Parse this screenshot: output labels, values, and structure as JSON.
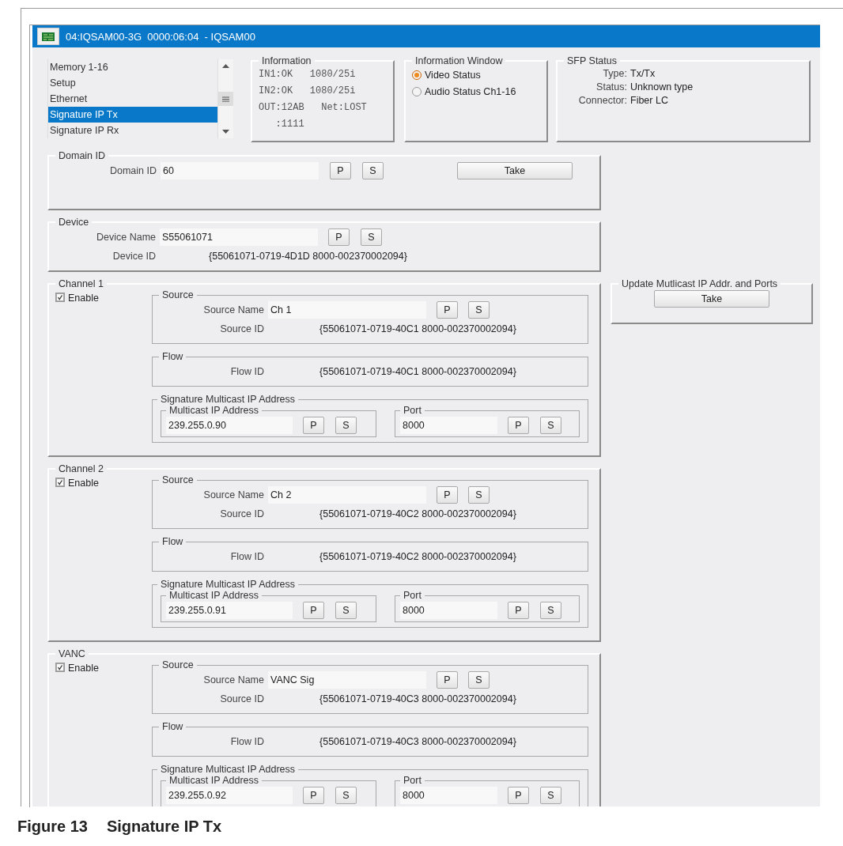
{
  "window": {
    "title": "04:IQSAM00-3G  0000:06:04  - IQSAM00"
  },
  "menu_list": {
    "items": [
      {
        "label": "Memory 1-16",
        "selected": false
      },
      {
        "label": "Setup",
        "selected": false
      },
      {
        "label": "Ethernet",
        "selected": false
      },
      {
        "label": "Signature IP Tx",
        "selected": true
      },
      {
        "label": "Signature IP Rx",
        "selected": false
      }
    ]
  },
  "information": {
    "title": "Information",
    "lines": [
      "IN1:OK   1080/25i",
      "IN2:OK   1080/25i",
      "OUT:12AB   Net:LOST",
      "   :1111"
    ]
  },
  "information_window": {
    "title": "Information Window",
    "options": [
      {
        "label": "Video Status",
        "selected": true
      },
      {
        "label": "Audio Status Ch1-16",
        "selected": false
      }
    ]
  },
  "sfp_status": {
    "title": "SFP Status",
    "rows": [
      {
        "label": "Type:",
        "value": "Tx/Tx"
      },
      {
        "label": "Status:",
        "value": "Unknown type"
      },
      {
        "label": "Connector:",
        "value": "Fiber LC"
      }
    ]
  },
  "domain_id": {
    "title": "Domain ID",
    "label": "Domain ID",
    "value": "60",
    "buttons": [
      "P",
      "S"
    ],
    "take": "Take"
  },
  "device": {
    "title": "Device",
    "name_label": "Device Name",
    "name_value": "S55061071",
    "buttons": [
      "P",
      "S"
    ],
    "id_label": "Device ID",
    "id_value": "{55061071-0719-4D1D 8000-002370002094}"
  },
  "channels": [
    {
      "title": "Channel 1",
      "enable": {
        "label": "Enable",
        "checked": true
      },
      "source": {
        "title": "Source",
        "name_label": "Source Name",
        "name_value": "Ch 1",
        "buttons": [
          "P",
          "S"
        ],
        "id_label": "Source ID",
        "id_value": "{55061071-0719-40C1 8000-002370002094}"
      },
      "flow": {
        "title": "Flow",
        "id_label": "Flow ID",
        "id_value": "{55061071-0719-40C1 8000-002370002094}"
      },
      "multicast": {
        "title": "Signature Multicast IP Address",
        "address": {
          "title": "Multicast IP Address",
          "value": "239.255.0.90",
          "buttons": [
            "P",
            "S"
          ]
        },
        "port": {
          "title": "Port",
          "value": "8000",
          "buttons": [
            "P",
            "S"
          ]
        }
      }
    },
    {
      "title": "Channel 2",
      "enable": {
        "label": "Enable",
        "checked": true
      },
      "source": {
        "title": "Source",
        "name_label": "Source Name",
        "name_value": "Ch 2",
        "buttons": [
          "P",
          "S"
        ],
        "id_label": "Source ID",
        "id_value": "{55061071-0719-40C2 8000-002370002094}"
      },
      "flow": {
        "title": "Flow",
        "id_label": "Flow ID",
        "id_value": "{55061071-0719-40C2 8000-002370002094}"
      },
      "multicast": {
        "title": "Signature Multicast IP Address",
        "address": {
          "title": "Multicast IP Address",
          "value": "239.255.0.91",
          "buttons": [
            "P",
            "S"
          ]
        },
        "port": {
          "title": "Port",
          "value": "8000",
          "buttons": [
            "P",
            "S"
          ]
        }
      }
    },
    {
      "title": "VANC",
      "enable": {
        "label": "Enable",
        "checked": true
      },
      "source": {
        "title": "Source",
        "name_label": "Source Name",
        "name_value": "VANC Sig",
        "buttons": [
          "P",
          "S"
        ],
        "id_label": "Source ID",
        "id_value": "{55061071-0719-40C3 8000-002370002094}"
      },
      "flow": {
        "title": "Flow",
        "id_label": "Flow ID",
        "id_value": "{55061071-0719-40C3 8000-002370002094}"
      },
      "multicast": {
        "title": "Signature Multicast IP Address",
        "address": {
          "title": "Multicast IP Address",
          "value": "239.255.0.92",
          "buttons": [
            "P",
            "S"
          ]
        },
        "port": {
          "title": "Port",
          "value": "8000",
          "buttons": [
            "P",
            "S"
          ]
        }
      }
    }
  ],
  "update_multicast": {
    "title": "Update Mutlicast IP Addr. and Ports",
    "button": "Take"
  },
  "caption": {
    "number": "Figure 13",
    "title": "Signature IP Tx"
  }
}
